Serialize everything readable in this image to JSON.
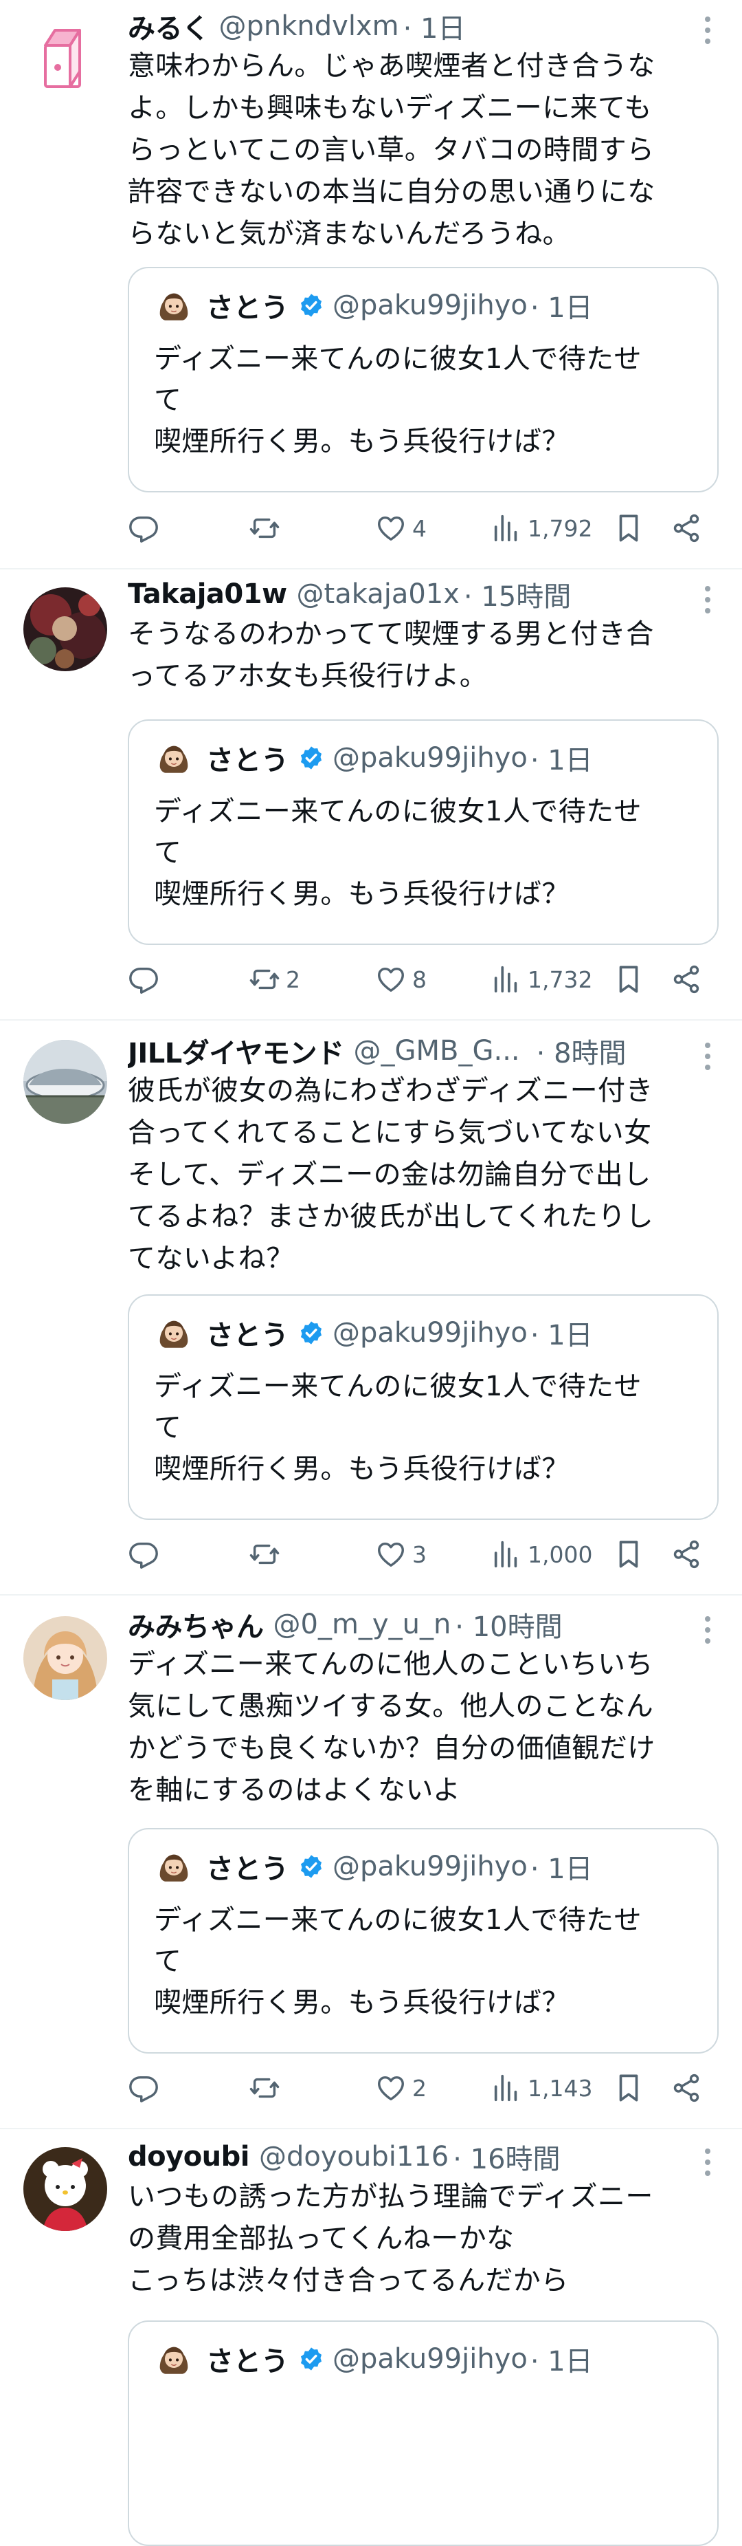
{
  "quoted": {
    "name": "さとう",
    "handle": "@paku99jihyo",
    "time": "· 1日",
    "text": "ディズニー来てんのに彼女1人で待たせ\nて\n喫煙所行く男。もう兵役行けば？"
  },
  "posts": [
    {
      "name": "みるく",
      "handle": "@pnkndvlxm",
      "time": "· 1日",
      "text": "意味わからん。じゃあ喫煙者と付き合うな\nよ。しかも興味もないディズニーに来ても\nらっといてこの言い草。タバコの時間すら\n許容できないの本当に自分の思い通りにな\nらないと気が済まないんだろうね。",
      "reposts": "",
      "likes": "4",
      "views": "1,792"
    },
    {
      "name": "Takaja01w",
      "handle": "@takaja01x",
      "time": "· 15時間",
      "text": "そうなるのわかってて喫煙する男と付き合\nってるアホ女も兵役行けよ。",
      "reposts": "2",
      "likes": "8",
      "views": "1,732"
    },
    {
      "name": "JILLダイヤモンド",
      "handle": "@_GMB_G...",
      "time": "· 8時間",
      "text": "彼氏が彼女の為にわざわざディズニー付き\n合ってくれてることにすら気づいてない女\nそして、ディズニーの金は勿論自分で出し\nてるよね？まさか彼氏が出してくれたりし\nてないよね？",
      "reposts": "",
      "likes": "3",
      "views": "1,000"
    },
    {
      "name": "みみちゃん",
      "handle": "@0_m_y_u_n",
      "time": "· 10時間",
      "text": "ディズニー来てんのに他人のこといちいち\n気にして愚痴ツイする女。他人のことなん\nかどうでも良くないか？自分の価値観だけ\nを軸にするのはよくないよ",
      "reposts": "",
      "likes": "2",
      "views": "1,143"
    },
    {
      "name": "doyoubi",
      "handle": "@doyoubi116",
      "time": "· 16時間",
      "text": "いつもの誘った方が払う理論でディズニー\nの費用全部払ってくんねーかな\nこっちは渋々付き合ってるんだから"
    }
  ],
  "icons": {
    "reply": "reply-icon",
    "repost": "repost-icon",
    "like": "like-icon",
    "views": "views-icon",
    "bookmark": "bookmark-icon",
    "share": "share-icon",
    "more": "more-icon",
    "verified": "verified-badge-icon"
  },
  "colors": {
    "text": "#0f1419",
    "secondary": "#536471",
    "verified": "#1d9bf0",
    "divider": "#eff3f4",
    "quote_border": "#cfd9de"
  }
}
